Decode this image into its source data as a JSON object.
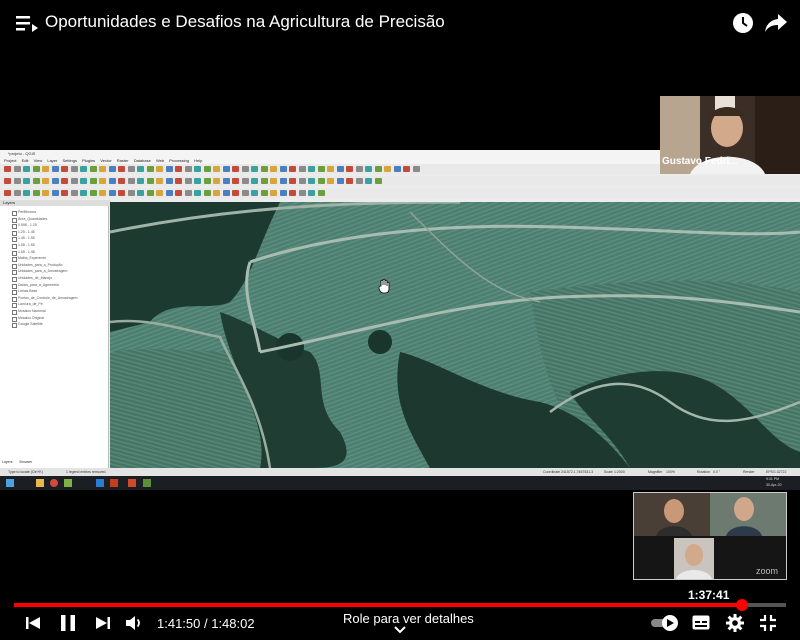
{
  "header": {
    "title": "Oportunidades e Desafios na Agricultura de Precisão"
  },
  "qgis": {
    "window_title": "*projeto - QGIS",
    "menu": [
      "Project",
      "Edit",
      "View",
      "Layer",
      "Settings",
      "Plugins",
      "Vector",
      "Raster",
      "Database",
      "Web",
      "Processing",
      "Help"
    ],
    "layers_panel_title": "Layers",
    "layers": [
      "Perfilbroma",
      "Área_Quantidades",
      "0.598 - 1.25",
      "1.25 - 1.45",
      "1.45 - 1.55",
      "1.55 - 1.65",
      "1.65 - 1.98",
      "Malha_Experimen",
      "Unidades_para_a_Produção",
      "Unidades_para_a_Amostragem",
      "Unidades_de_Manejo",
      "Dados_para_a_Agrimetria",
      "Linhas Base",
      "Pontos_de_Controle_de_Amostragem",
      "Lavoura_de_Pe",
      "Mosaico Nacional",
      "Mosaico Original",
      "Google Satellite"
    ],
    "panel_tabs": [
      "Layers",
      "Browser"
    ],
    "search_placeholder": "Type to locate (Ctrl+K)",
    "status_legend": "1 legend entries removed.",
    "status_coordinate_label": "Coordinate",
    "status_coordinate": "241572.1,7467531.3",
    "status_scale_label": "Scale",
    "status_scale": "1:2000",
    "status_magnifier_label": "Magnifier",
    "status_magnifier": "100%",
    "status_rotation_label": "Rotation",
    "status_rotation": "0.0 °",
    "status_render": "Render",
    "status_epsg": "EPSG:32722",
    "clock_time": "9:31 PM",
    "clock_date": "30-Apr-20"
  },
  "zoom": {
    "participant_name": "Gustavo Fedri...",
    "gallery_logo": "zoom"
  },
  "player": {
    "progress_fraction": 0.943,
    "scrub_time": "1:37:41",
    "time_display": "1:41:50 / 1:48:02",
    "scroll_hint": "Role para ver detalhes"
  },
  "colors": {
    "progress": "#ff0000",
    "track": "#555555"
  }
}
